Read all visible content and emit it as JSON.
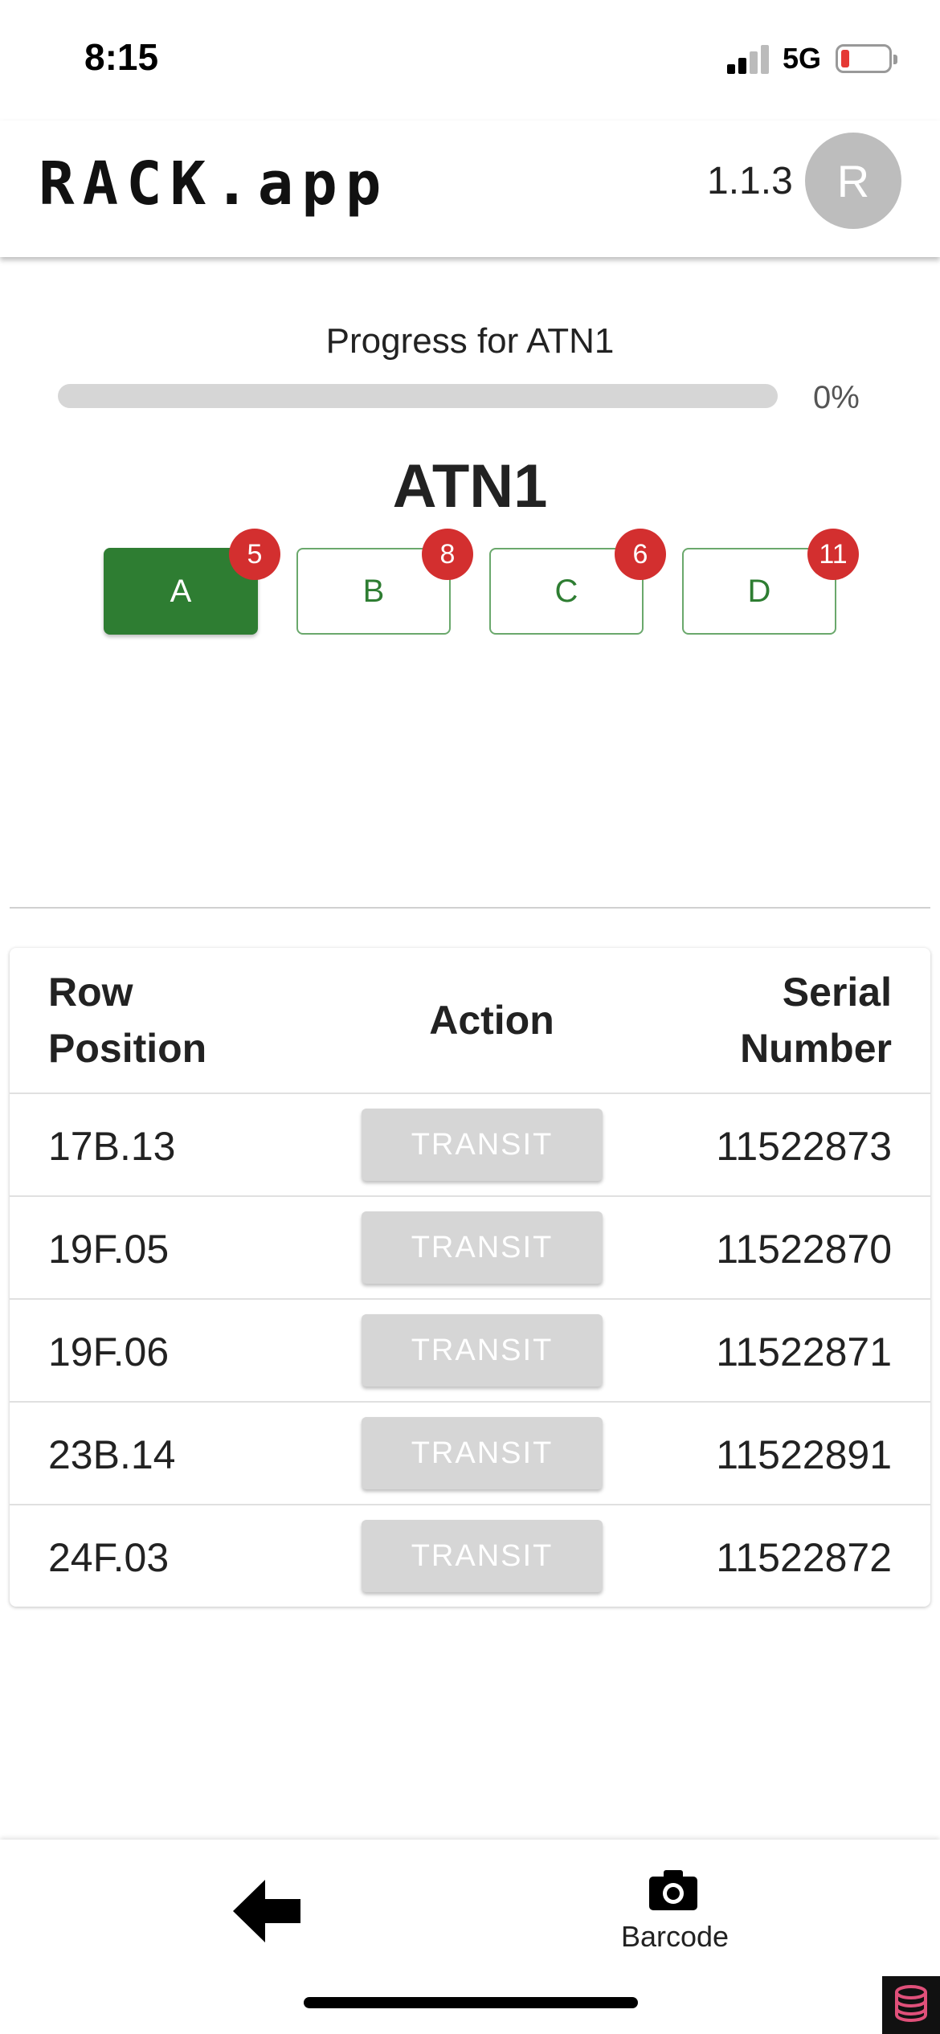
{
  "status_bar": {
    "time": "8:15",
    "network": "5G",
    "icons": [
      "signal-icon",
      "battery-icon"
    ],
    "battery_color": "#e53935"
  },
  "app_bar": {
    "title": "RACK.app",
    "version": "1.1.3",
    "avatar_initial": "R"
  },
  "progress": {
    "label": "Progress for ATN1",
    "percent_text": "0%",
    "value": 0
  },
  "rack": {
    "title": "ATN1",
    "sections": [
      {
        "label": "A",
        "count": "5",
        "active": true
      },
      {
        "label": "B",
        "count": "8",
        "active": false
      },
      {
        "label": "C",
        "count": "6",
        "active": false
      },
      {
        "label": "D",
        "count": "11",
        "active": false
      }
    ]
  },
  "table": {
    "headers": {
      "row_position": [
        "Row",
        "Position"
      ],
      "action": "Action",
      "serial_number": [
        "Serial",
        "Number"
      ]
    },
    "rows": [
      {
        "position": "17B.13",
        "action": "TRANSIT",
        "serial": "11522873"
      },
      {
        "position": "19F.05",
        "action": "TRANSIT",
        "serial": "11522870"
      },
      {
        "position": "19F.06",
        "action": "TRANSIT",
        "serial": "11522871"
      },
      {
        "position": "23B.14",
        "action": "TRANSIT",
        "serial": "11522891"
      },
      {
        "position": "24F.03",
        "action": "TRANSIT",
        "serial": "11522872"
      }
    ]
  },
  "bottom_bar": {
    "back_icon": "arrow-left-icon",
    "barcode_icon": "camera-icon",
    "barcode_label": "Barcode"
  },
  "colors": {
    "primary_green": "#2e7d32",
    "badge_red": "#d32f2f",
    "disabled_gray": "#d6d6d6"
  }
}
